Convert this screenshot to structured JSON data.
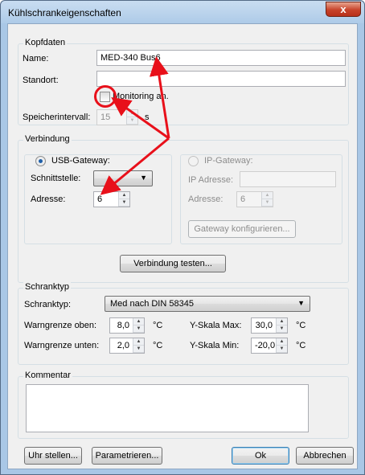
{
  "window": {
    "title": "Kühlschrankeigenschaften",
    "close_glyph": "x"
  },
  "kopfdaten": {
    "group_label": "Kopfdaten",
    "name_label": "Name:",
    "name_value": "MED-340 Bus6",
    "standort_label": "Standort:",
    "standort_value": "",
    "monitoring_label": "Monitoring an.",
    "monitoring_checked": false,
    "speicher_label": "Speicherintervall:",
    "speicher_value": "15",
    "speicher_unit": "s"
  },
  "verbindung": {
    "group_label": "Verbindung",
    "usb": {
      "label": "USB-Gateway:",
      "selected": true,
      "schnittstelle_label": "Schnittstelle:",
      "schnittstelle_value": "",
      "adresse_label": "Adresse:",
      "adresse_value": "6"
    },
    "ip": {
      "label": "IP-Gateway:",
      "selected": false,
      "ip_label": "IP Adresse:",
      "ip_value": "",
      "adresse_label": "Adresse:",
      "adresse_value": "6",
      "configure_label": "Gateway konfigurieren..."
    },
    "test_label": "Verbindung testen..."
  },
  "schranktyp": {
    "group_label": "Schranktyp",
    "type_label": "Schranktyp:",
    "type_value": "Med nach DIN 58345",
    "warn_oben_label": "Warngrenze oben:",
    "warn_oben_value": "8,0",
    "warn_unten_label": "Warngrenze unten:",
    "warn_unten_value": "2,0",
    "ymax_label": "Y-Skala Max:",
    "ymax_value": "30,0",
    "ymin_label": "Y-Skala Min:",
    "ymin_value": "-20,0",
    "unit": "°C"
  },
  "kommentar": {
    "group_label": "Kommentar",
    "value": ""
  },
  "footer": {
    "uhr_label": "Uhr stellen...",
    "param_label": "Parametrieren...",
    "ok_label": "Ok",
    "cancel_label": "Abbrechen"
  },
  "icons": {
    "spin_up": "▲",
    "spin_down": "▼",
    "dropdown": "▼"
  },
  "colors": {
    "annotation_red": "#e8101a",
    "radio_selected": "#1f5fa8"
  }
}
